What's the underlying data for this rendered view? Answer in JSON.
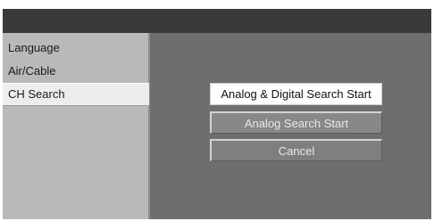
{
  "sidebar": {
    "items": [
      {
        "label": "Language"
      },
      {
        "label": "Air/Cable"
      },
      {
        "label": "CH Search",
        "selected": true
      }
    ]
  },
  "main": {
    "buttons": [
      {
        "label": "Analog & Digital Search Start",
        "state": "focused"
      },
      {
        "label": "Analog Search Start"
      },
      {
        "label": "Cancel"
      }
    ]
  },
  "colors": {
    "header": "#3a3a3a",
    "sidebar_bg": "#b9b9bb",
    "main_bg": "#6e6e70",
    "focused_button": "#ffffff",
    "button_bg": "#888889"
  }
}
